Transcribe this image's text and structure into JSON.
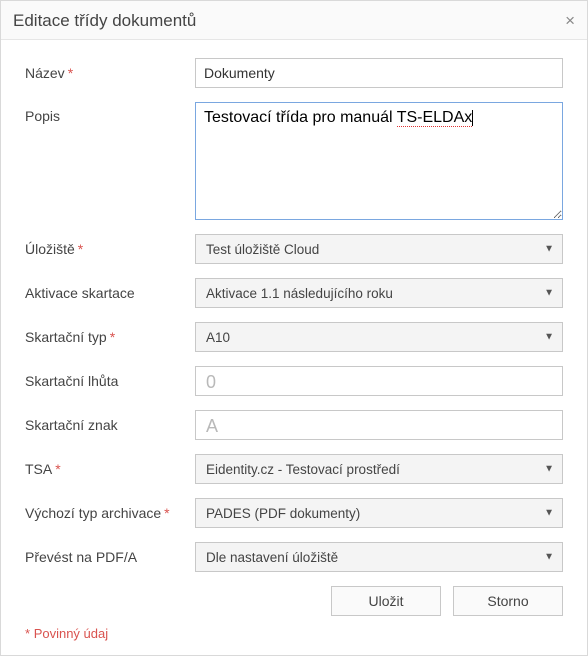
{
  "title": "Editace třídy dokumentů",
  "labels": {
    "name": "Název",
    "desc": "Popis",
    "storage": "Úložiště",
    "shred_activate": "Aktivace skartace",
    "shred_type": "Skartační typ",
    "shred_period": "Skartační lhůta",
    "shred_mark": "Skartační znak",
    "tsa": "TSA",
    "archive_default": "Výchozí typ archivace",
    "convert_pdfa": "Převést na PDF/A"
  },
  "required_marker": "*",
  "values": {
    "name": "Dokumenty",
    "desc_plain_prefix": "Testovací třída pro manuál ",
    "desc_underlined": "TS-ELDAx",
    "storage": "Test úložiště Cloud",
    "shred_activate": "Aktivace 1.1 následujícího roku",
    "shred_type": "A10",
    "shred_period": "0",
    "shred_mark": "A",
    "tsa": "Eidentity.cz - Testovací prostředí",
    "archive_default": "PADES (PDF dokumenty)",
    "convert_pdfa": "Dle nastavení úložiště"
  },
  "buttons": {
    "save": "Uložit",
    "cancel": "Storno"
  },
  "footnote": "Povinný údaj",
  "icons": {
    "close": "×",
    "dropdown": "▼"
  }
}
